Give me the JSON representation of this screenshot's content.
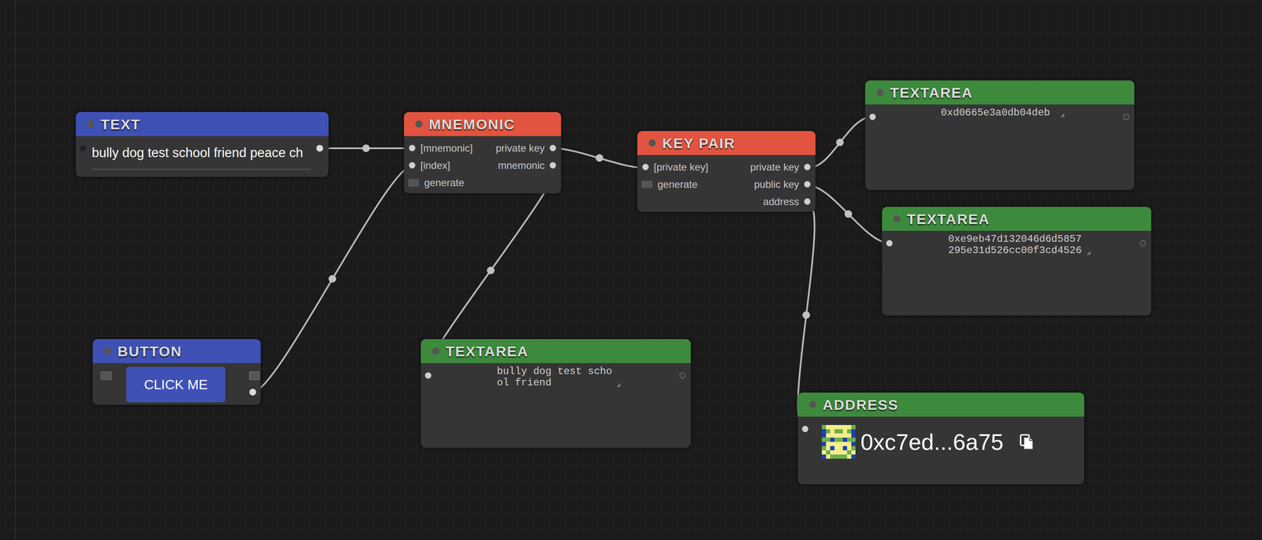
{
  "nodes": [
    {
      "title": "TEXT",
      "kind": "text",
      "color": "#3f51b5",
      "value": "bully dog test school friend peace ch"
    },
    {
      "title": "BUTTON",
      "kind": "button",
      "color": "#3f51b5",
      "button": "CLICK ME"
    },
    {
      "title": "MNEMONIC",
      "kind": "ports",
      "color": "#e2543f",
      "inputs": [
        {
          "label": "[mnemonic]",
          "kind": "port"
        },
        {
          "label": "[index]",
          "kind": "port"
        },
        {
          "label": "generate",
          "kind": "checkbox",
          "checked": false
        }
      ],
      "outputs": [
        "private key",
        "mnemonic"
      ]
    },
    {
      "title": "KEY PAIR",
      "kind": "ports",
      "color": "#e2543f",
      "inputs": [
        {
          "label": "[private key]",
          "kind": "port"
        },
        {
          "label": "generate",
          "kind": "checkbox",
          "checked": false
        }
      ],
      "outputs": [
        "private key",
        "public key",
        "address"
      ]
    },
    {
      "title": "TEXTAREA",
      "kind": "textarea",
      "color": "#3d8a3d",
      "value": "0xd0665e3a0db04deb"
    },
    {
      "title": "TEXTAREA",
      "kind": "textarea",
      "color": "#3d8a3d",
      "value": "0xe9eb47d132046d6d5857295e31d526cc00f3cd4526"
    },
    {
      "title": "TEXTAREA",
      "kind": "textarea",
      "color": "#3d8a3d",
      "value": "bully dog test school friend"
    },
    {
      "title": "ADDRESS",
      "kind": "address",
      "color": "#3d8a3d",
      "value": "0xc7ed...6a75"
    }
  ]
}
